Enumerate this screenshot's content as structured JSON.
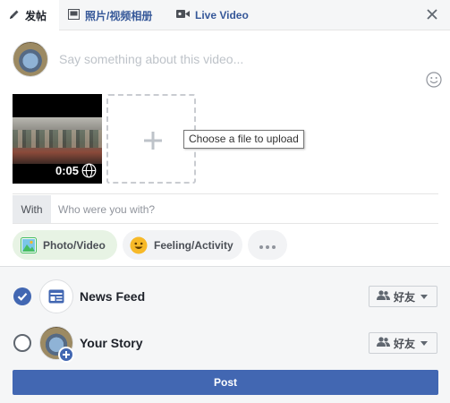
{
  "tabs": [
    {
      "label": "发帖",
      "icon": "pencil-icon"
    },
    {
      "label": "照片/视频相册",
      "icon": "photo-album-icon"
    },
    {
      "label": "Live Video",
      "icon": "live-video-icon"
    }
  ],
  "composer": {
    "placeholder": "Say something about this video..."
  },
  "media": {
    "duration": "0:05",
    "add_tooltip": "Choose a file to upload"
  },
  "with": {
    "label": "With",
    "placeholder": "Who were you with?"
  },
  "actions": [
    {
      "label": "Photo/Video",
      "icon": "photo-icon"
    },
    {
      "label": "Feeling/Activity",
      "icon": "smiley-icon"
    },
    {
      "label": "",
      "icon": "more-icon"
    }
  ],
  "destinations": [
    {
      "label": "News Feed",
      "checked": true,
      "audience": "好友"
    },
    {
      "label": "Your Story",
      "checked": false,
      "audience": "好友"
    }
  ],
  "post_label": "Post",
  "colors": {
    "brand": "#4267b2",
    "link": "#365899",
    "photo_pill_bg": "#e7f3e4"
  }
}
